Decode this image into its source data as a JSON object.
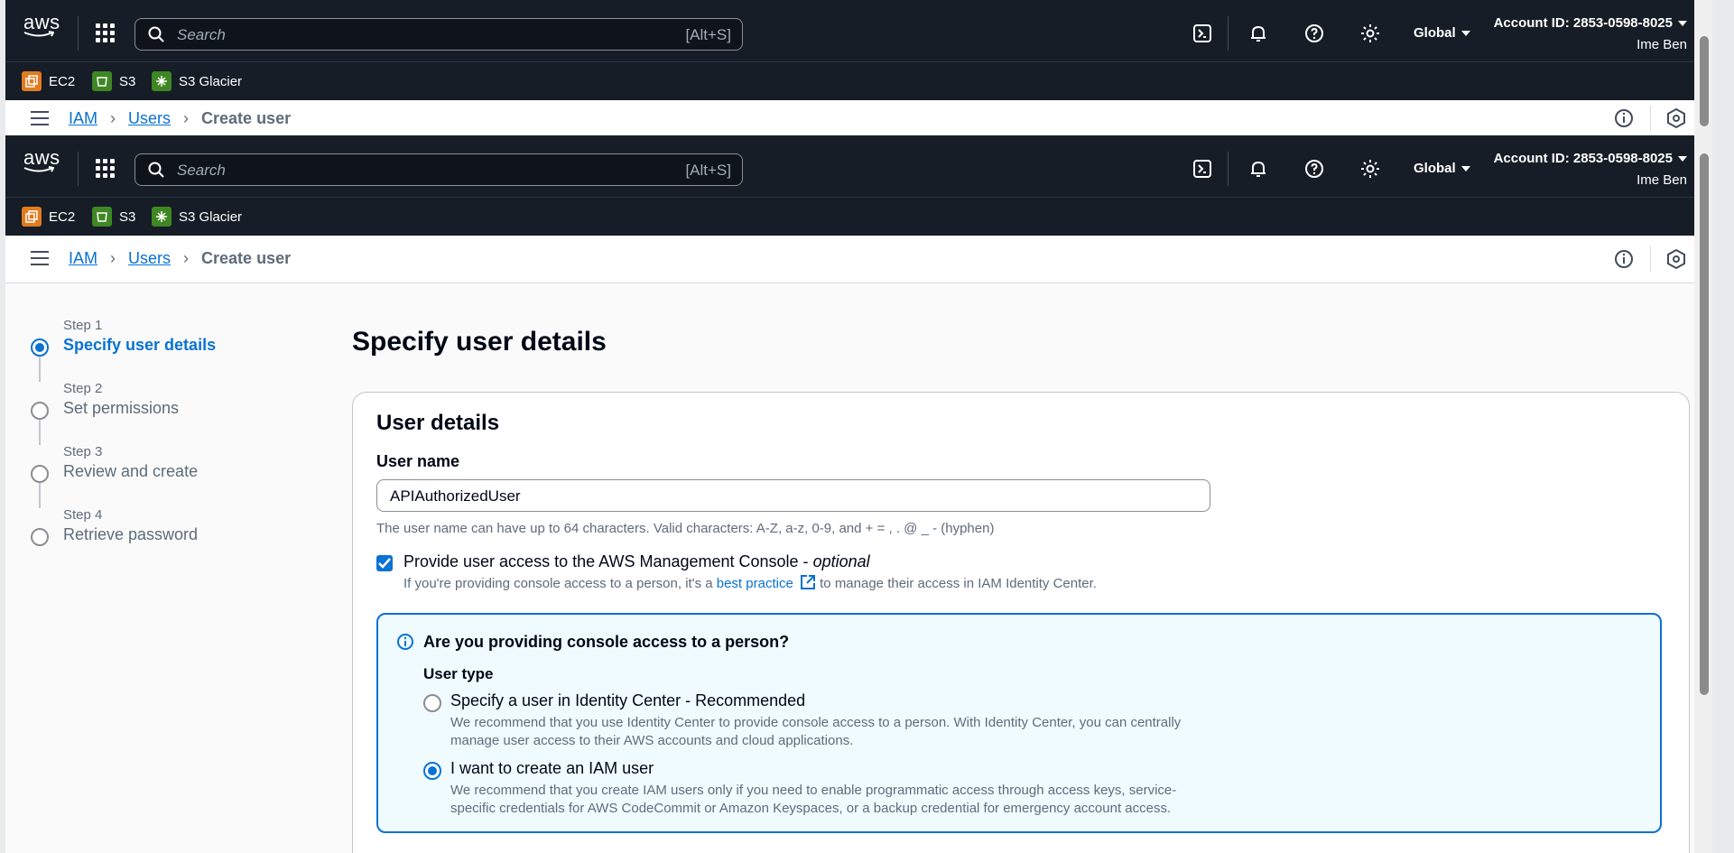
{
  "topbar": {
    "logo_text": "aws",
    "search_placeholder": "Search",
    "search_shortcut": "[Alt+S]",
    "region": "Global",
    "account_id": "Account ID: 2853-0598-8025",
    "user_name": "Ime Ben"
  },
  "favorites": [
    {
      "label": "EC2",
      "color": "#e07b1f"
    },
    {
      "label": "S3",
      "color": "#3f8624"
    },
    {
      "label": "S3 Glacier",
      "color": "#3f8624"
    }
  ],
  "breadcrumb": {
    "iam": "IAM",
    "users": "Users",
    "current": "Create user"
  },
  "steps": [
    {
      "num": "Step 1",
      "label": "Specify user details"
    },
    {
      "num": "Step 2",
      "label": "Set permissions"
    },
    {
      "num": "Step 3",
      "label": "Review and create"
    },
    {
      "num": "Step 4",
      "label": "Retrieve password"
    }
  ],
  "page_title": "Specify user details",
  "card": {
    "title": "User details",
    "username_label": "User name",
    "username_value": "APIAuthorizedUser",
    "username_hint": "The user name can have up to 64 characters. Valid characters: A-Z, a-z, 0-9, and + = , . @ _ - (hyphen)",
    "console_access_label": "Provide user access to the AWS Management Console - ",
    "console_access_optional": "optional",
    "console_desc_pre": "If you're providing console access to a person, it's a ",
    "console_desc_link": "best practice",
    "console_desc_post": " to manage their access in IAM Identity Center."
  },
  "infobox": {
    "title": "Are you providing console access to a person?",
    "user_type_label": "User type",
    "option1_label": "Specify a user in Identity Center - Recommended",
    "option1_desc": "We recommend that you use Identity Center to provide console access to a person. With Identity Center, you can centrally manage user access to their AWS accounts and cloud applications.",
    "option2_label": "I want to create an IAM user",
    "option2_desc": "We recommend that you create IAM users only if you need to enable programmatic access through access keys, service-specific credentials for AWS CodeCommit or Amazon Keyspaces, or a backup credential for emergency account access.",
    "selected": "option2"
  },
  "colors": {
    "topbar": "#161d26",
    "accent": "#0972d3",
    "info_bg": "#f0fbff"
  }
}
